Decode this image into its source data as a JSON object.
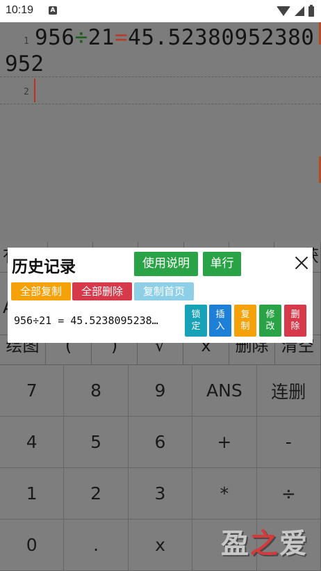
{
  "status_bar": {
    "time": "10:19",
    "notification_icon": "A"
  },
  "editor": {
    "line1": {
      "number": "1",
      "operand1": "956",
      "operator": "÷",
      "operand2": "21",
      "equals": "=",
      "result_part1": "45.52380952380",
      "result_part2": "952"
    },
    "line2": {
      "number": "2"
    }
  },
  "function_rows": {
    "row_top": [
      "有",
      "",
      "",
      "",
      "",
      "",
      "获"
    ],
    "row_mid": [
      "A",
      "",
      "",
      "",
      "",
      "",
      ""
    ],
    "row_bottom": [
      "绘图",
      "(",
      ")",
      "√",
      "x",
      "删除",
      "清空"
    ]
  },
  "keypad": {
    "keys": [
      "7",
      "8",
      "9",
      "ANS",
      "连删",
      "4",
      "5",
      "6",
      "+",
      "-",
      "1",
      "2",
      "3",
      "*",
      "÷",
      "0",
      ".",
      "x",
      "",
      ""
    ]
  },
  "watermark": {
    "text": "盈之爱"
  },
  "history_dialog": {
    "title": "历史记录",
    "help_button": "使用说明",
    "single_line_button": "单行",
    "copy_all": "全部复制",
    "delete_all": "全部删除",
    "copy_first_page": "复制首页",
    "entry": "956÷21 = 45.5238095238…",
    "actions": {
      "lock": "锁定",
      "insert": "插入",
      "copy": "复制",
      "edit": "修改",
      "delete": "删除"
    }
  },
  "colors": {
    "green": "#2aa347",
    "orange": "#f5a10a",
    "red": "#d63a4a",
    "light_blue": "#8ecfe8",
    "teal": "#17a2b8",
    "blue": "#1e7fd6"
  }
}
